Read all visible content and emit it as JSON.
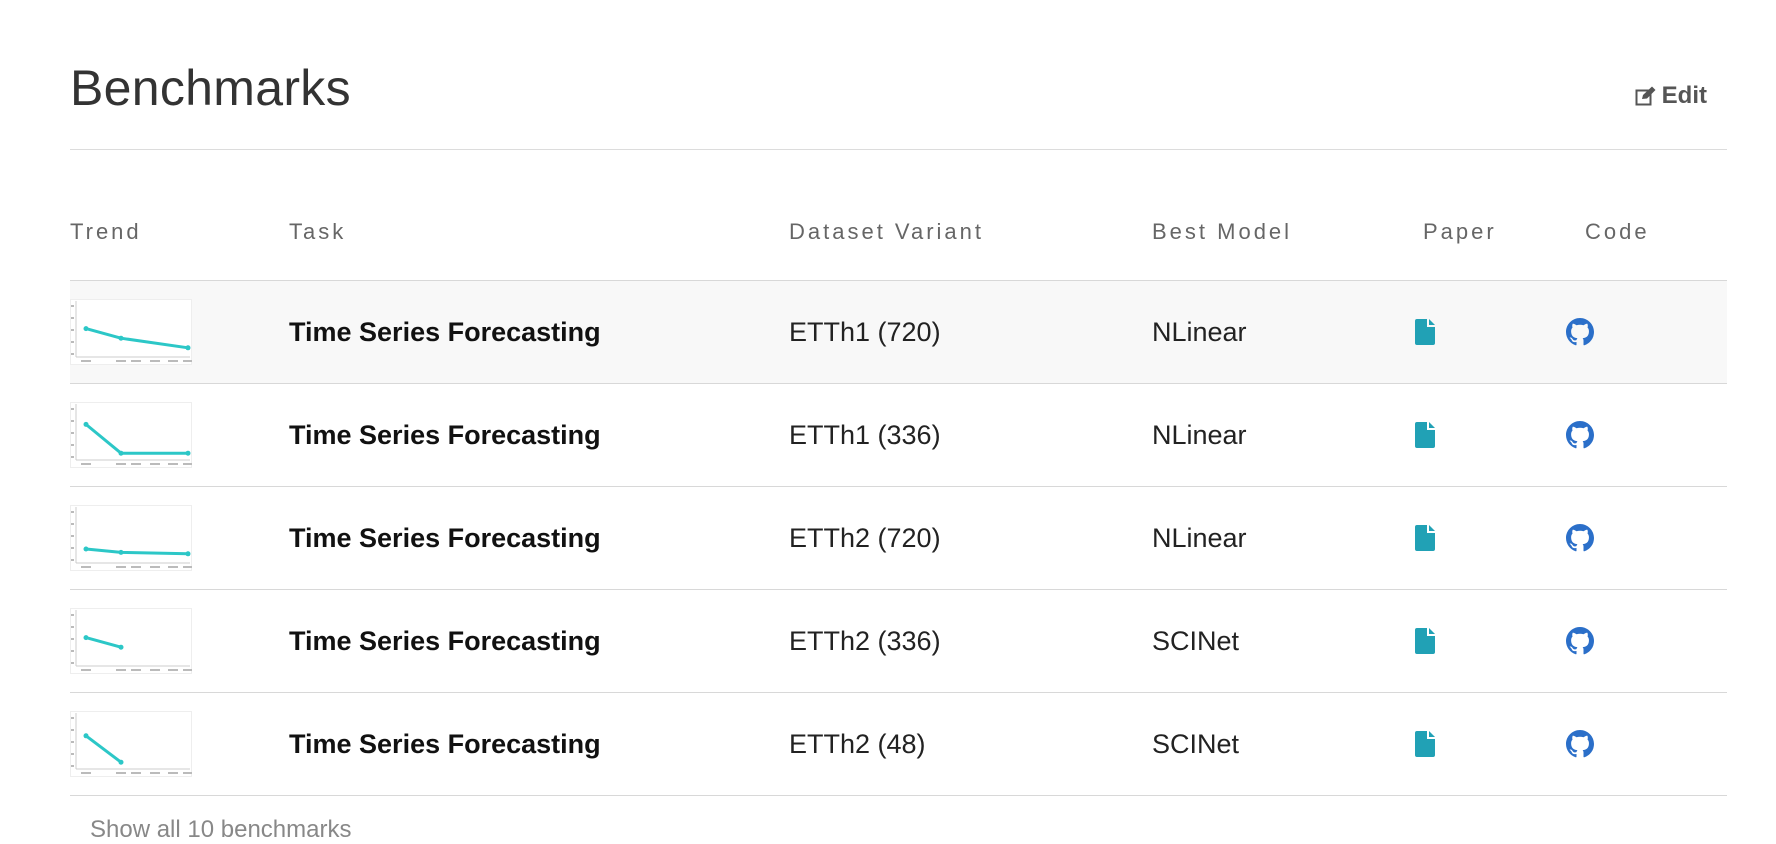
{
  "page": {
    "title": "Benchmarks",
    "edit_label": "Edit",
    "show_all_label": "Show all 10 benchmarks"
  },
  "table": {
    "columns": [
      "Trend",
      "Task",
      "Dataset Variant",
      "Best Model",
      "Paper",
      "Code"
    ],
    "rows": [
      {
        "task": "Time Series Forecasting",
        "variant": "ETTh1 (720)",
        "model": "NLinear",
        "trend": [
          0.55,
          0.35,
          0.15
        ]
      },
      {
        "task": "Time Series Forecasting",
        "variant": "ETTh1 (336)",
        "model": "NLinear",
        "trend": [
          0.7,
          0.1,
          0.1
        ]
      },
      {
        "task": "Time Series Forecasting",
        "variant": "ETTh2 (720)",
        "model": "NLinear",
        "trend": [
          0.25,
          0.18,
          0.15
        ]
      },
      {
        "task": "Time Series Forecasting",
        "variant": "ETTh2 (336)",
        "model": "SCINet",
        "trend": [
          0.55,
          0.35
        ]
      },
      {
        "task": "Time Series Forecasting",
        "variant": "ETTh2 (48)",
        "model": "SCINet",
        "trend": [
          0.65,
          0.1
        ]
      }
    ]
  },
  "icons": {
    "edit": "edit-icon",
    "paper": "file-icon",
    "code": "github-icon"
  },
  "colors": {
    "trend_line": "#2cc7c7",
    "paper_icon": "#21a1b5",
    "code_icon": "#2b6fc9"
  }
}
